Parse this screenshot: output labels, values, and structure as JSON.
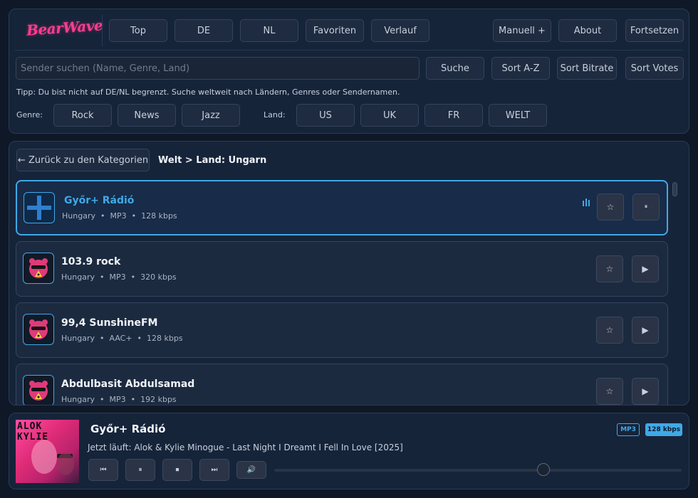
{
  "app": {
    "logo": "BearWave"
  },
  "nav": {
    "left": [
      "Top",
      "DE",
      "NL",
      "Favoriten",
      "Verlauf"
    ],
    "right": [
      "Manuell +",
      "About",
      "Fortsetzen"
    ]
  },
  "search": {
    "placeholder": "Sender suchen (Name, Genre, Land)",
    "value": "",
    "submit": "Suche",
    "sort": [
      "Sort A-Z",
      "Sort Bitrate",
      "Sort Votes"
    ]
  },
  "tip": "Tipp: Du bist nicht auf DE/NL begrenzt. Suche weltweit nach Ländern, Genres oder Sendernamen.",
  "filters": {
    "genre_label": "Genre:",
    "genres": [
      "Rock",
      "News",
      "Jazz"
    ],
    "country_label": "Land:",
    "countries": [
      "US",
      "UK",
      "FR",
      "WELT"
    ]
  },
  "list": {
    "back": "← Zurück zu den Kategorien",
    "breadcrumb": "Welt > Land: Ungarn",
    "stations": [
      {
        "name": "Győr+ Rádió",
        "country": "Hungary",
        "codec": "MP3",
        "bitrate": "128 kbps",
        "active": true
      },
      {
        "name": "103.9 rock",
        "country": "Hungary",
        "codec": "MP3",
        "bitrate": "320 kbps",
        "active": false
      },
      {
        "name": "99,4 SunshineFM",
        "country": "Hungary",
        "codec": "AAC+",
        "bitrate": "128 kbps",
        "active": false
      },
      {
        "name": "Abdulbasit Abdulsamad",
        "country": "Hungary",
        "codec": "MP3",
        "bitrate": "192 kbps",
        "active": false
      }
    ],
    "meta_separator": "•",
    "favorite_glyph": "☆",
    "play_glyph": "▶",
    "pause_glyph": "⏸"
  },
  "player": {
    "cover_text": "ALOK KYLIE",
    "station": "Győr+ Rádió",
    "now_playing": "Jetzt läuft: Alok & Kylie Minogue - Last Night I Dreamt I Fell In Love [2025]",
    "codec": "MP3",
    "bitrate": "128 kbps",
    "controls": [
      "⏮",
      "⏸",
      "⏹",
      "⏭",
      "🔊"
    ],
    "volume": 0.66
  },
  "colors": {
    "accent": "#3fa9e7",
    "logo": "#ff3c8e",
    "background": "#0f1827"
  }
}
